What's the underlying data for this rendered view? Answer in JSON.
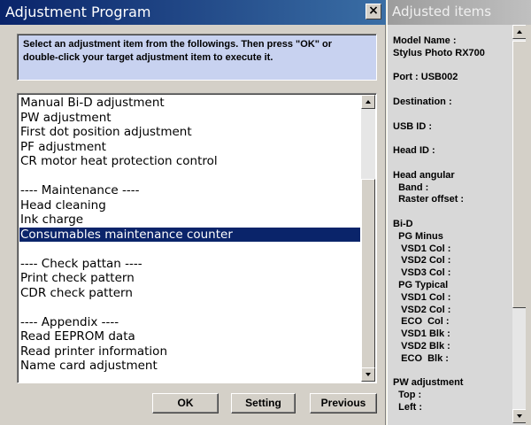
{
  "window": {
    "title": "Adjustment Program",
    "close_glyph": "×"
  },
  "instruction": {
    "line1": "Select an adjustment item from the followings. Then press \"OK\" or",
    "line2": "double-click your target adjustment item to execute it."
  },
  "list": {
    "items": [
      "Manual Bi-D adjustment",
      "PW adjustment",
      "First dot position adjustment",
      "PF adjustment",
      "CR motor heat protection control",
      "",
      "---- Maintenance ----",
      "Head cleaning",
      "Ink charge",
      "Consumables maintenance counter",
      "",
      "---- Check pattan ----",
      "Print check pattern",
      "CDR check pattern",
      "",
      "---- Appendix ----",
      "Read EEPROM data",
      "Read printer information",
      "Name card adjustment"
    ],
    "selected_index": 9
  },
  "buttons": {
    "ok": "OK",
    "setting": "Setting",
    "previous": "Previous"
  },
  "panel": {
    "title": "Adjusted items",
    "lines": [
      "Model Name :",
      "Stylus Photo RX700",
      "",
      "Port : USB002",
      "",
      "Destination :",
      "",
      "USB ID :",
      "",
      "Head ID :",
      "",
      "Head angular",
      "  Band :",
      "  Raster offset :",
      "",
      "Bi-D",
      "  PG Minus",
      "   VSD1 Col :",
      "   VSD2 Col :",
      "   VSD3 Col :",
      "  PG Typical",
      "   VSD1 Col :",
      "   VSD2 Col :",
      "   ECO  Col :",
      "   VSD1 Blk :",
      "   VSD2 Blk :",
      "   ECO  Blk :",
      "",
      "PW adjustment",
      "  Top :",
      "  Left :"
    ]
  },
  "colors": {
    "title_active": "#0A246A",
    "selection": "#0A246A",
    "instruction_bg": "#C8D2F0"
  }
}
